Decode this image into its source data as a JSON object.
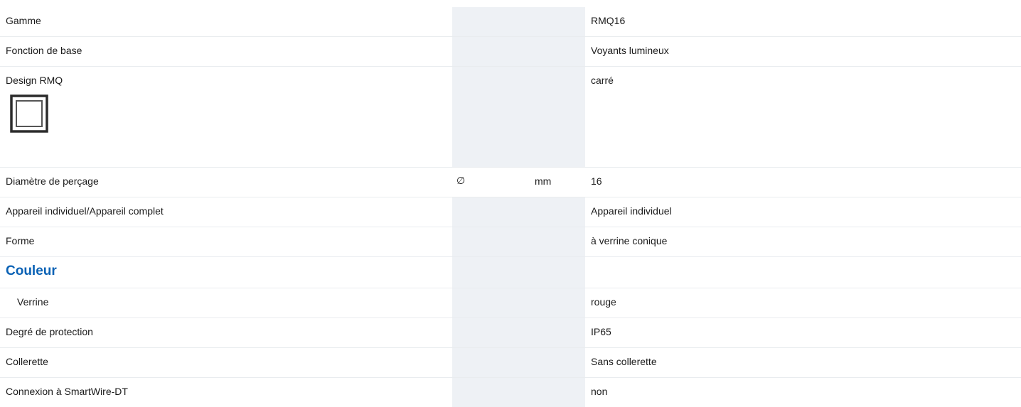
{
  "rows": {
    "gamme": {
      "label": "Gamme",
      "value": "RMQ16"
    },
    "fonction": {
      "label": "Fonction de base",
      "value": "Voyants lumineux"
    },
    "design": {
      "label": "Design RMQ",
      "value": "carré",
      "icon": "square-design-icon"
    },
    "diametre": {
      "label": "Diamètre de perçage",
      "symbol": "∅",
      "unit": "mm",
      "value": "16"
    },
    "appareil": {
      "label": "Appareil individuel/Appareil complet",
      "value": "Appareil individuel"
    },
    "forme": {
      "label": "Forme",
      "value": "à verrine conique"
    },
    "couleur": {
      "title": "Couleur"
    },
    "verrine": {
      "label": "Verrine",
      "value": "rouge"
    },
    "protection": {
      "label": "Degré de protection",
      "value": "IP65"
    },
    "collerette": {
      "label": "Collerette",
      "value": "Sans collerette"
    },
    "smartwire": {
      "label": "Connexion à SmartWire-DT",
      "value": "non"
    }
  },
  "colors": {
    "section_title": "#0a62b5",
    "shaded_column": "#eef1f5",
    "row_border": "#e9ecef"
  }
}
